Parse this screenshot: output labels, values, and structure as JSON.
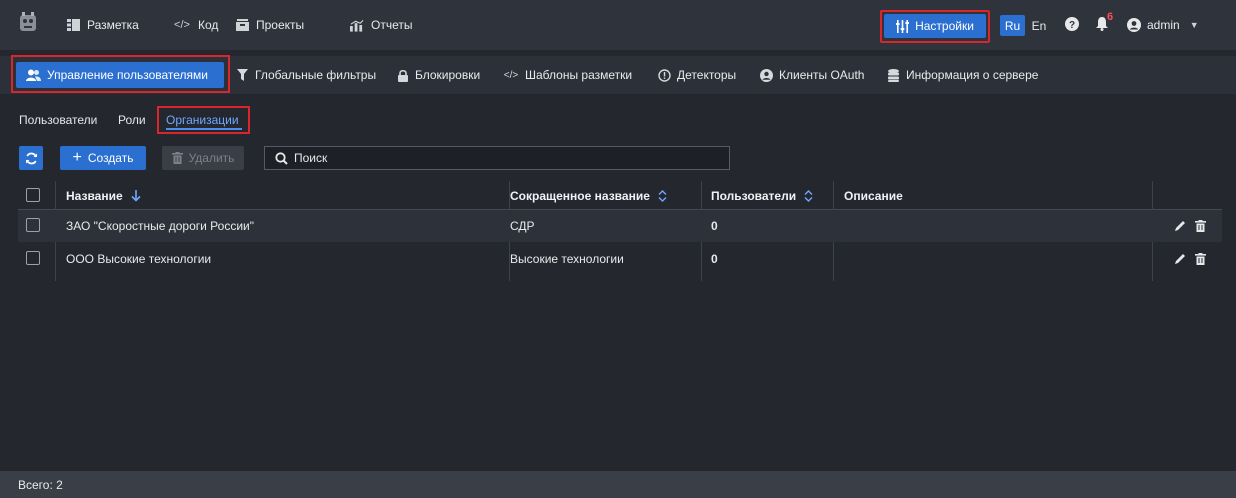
{
  "topnav": {
    "items": [
      {
        "label": "Разметка",
        "icon": "markup-icon"
      },
      {
        "label": "Код",
        "icon": "code-icon"
      },
      {
        "label": "Проекты",
        "icon": "projects-icon"
      },
      {
        "label": "Отчеты",
        "icon": "reports-icon"
      }
    ],
    "settings_label": "Настройки",
    "lang_ru": "Ru",
    "lang_en": "En",
    "notifications_count": "6",
    "user_name": "admin"
  },
  "subnav": {
    "active": "Управление пользователями",
    "items": [
      {
        "label": "Глобальные фильтры",
        "icon": "filter-icon"
      },
      {
        "label": "Блокировки",
        "icon": "lock-icon"
      },
      {
        "label": "Шаблоны разметки",
        "icon": "code-icon"
      },
      {
        "label": "Детекторы",
        "icon": "alert-circle-icon"
      },
      {
        "label": "Клиенты OAuth",
        "icon": "user-circle-icon"
      },
      {
        "label": "Информация о сервере",
        "icon": "database-icon"
      }
    ]
  },
  "tabs": [
    "Пользователи",
    "Роли",
    "Организации"
  ],
  "active_tab": "Организации",
  "toolbar": {
    "create_label": "Создать",
    "delete_label": "Удалить",
    "search_placeholder": "Поиск"
  },
  "table": {
    "columns": [
      "Название",
      "Сокращенное название",
      "Пользователи",
      "Описание"
    ],
    "rows": [
      {
        "name": "ЗАО \"Скоростные дороги России\"",
        "short": "СДР",
        "users": "0",
        "description": ""
      },
      {
        "name": "ООО Высокие технологии",
        "short": "Высокие технологии",
        "users": "0",
        "description": ""
      }
    ]
  },
  "footer": {
    "total": "Всего: 2"
  },
  "colors": {
    "accent": "#2b6fd1",
    "highlight": "#d9262c",
    "background": "#24272e"
  }
}
